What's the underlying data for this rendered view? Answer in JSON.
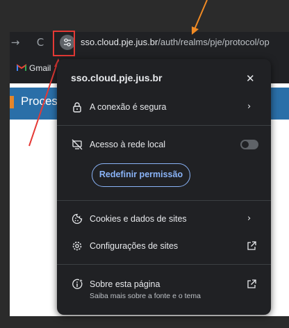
{
  "browser": {
    "back_icon": "→",
    "reload_icon": "C",
    "url_host": "sso.cloud.pje.jus.br",
    "url_path": "/auth/realms/pje/protocol/op",
    "bookmark": "Gmail"
  },
  "page": {
    "title_fragment": "Proces"
  },
  "popup": {
    "title": "sso.cloud.pje.jus.br",
    "close": "✕",
    "secure_connection": "A conexão é segura",
    "local_network": "Acesso à rede local",
    "reset_permission": "Redefinir permissão",
    "cookies": "Cookies e dados de sites",
    "site_settings": "Configurações de sites",
    "about_title": "Sobre esta página",
    "about_subtitle": "Saiba mais sobre a fonte e o tema"
  },
  "colors": {
    "annotation_orange": "#f08a24",
    "annotation_red": "#e53935",
    "accent_blue": "#8ab4f8"
  }
}
